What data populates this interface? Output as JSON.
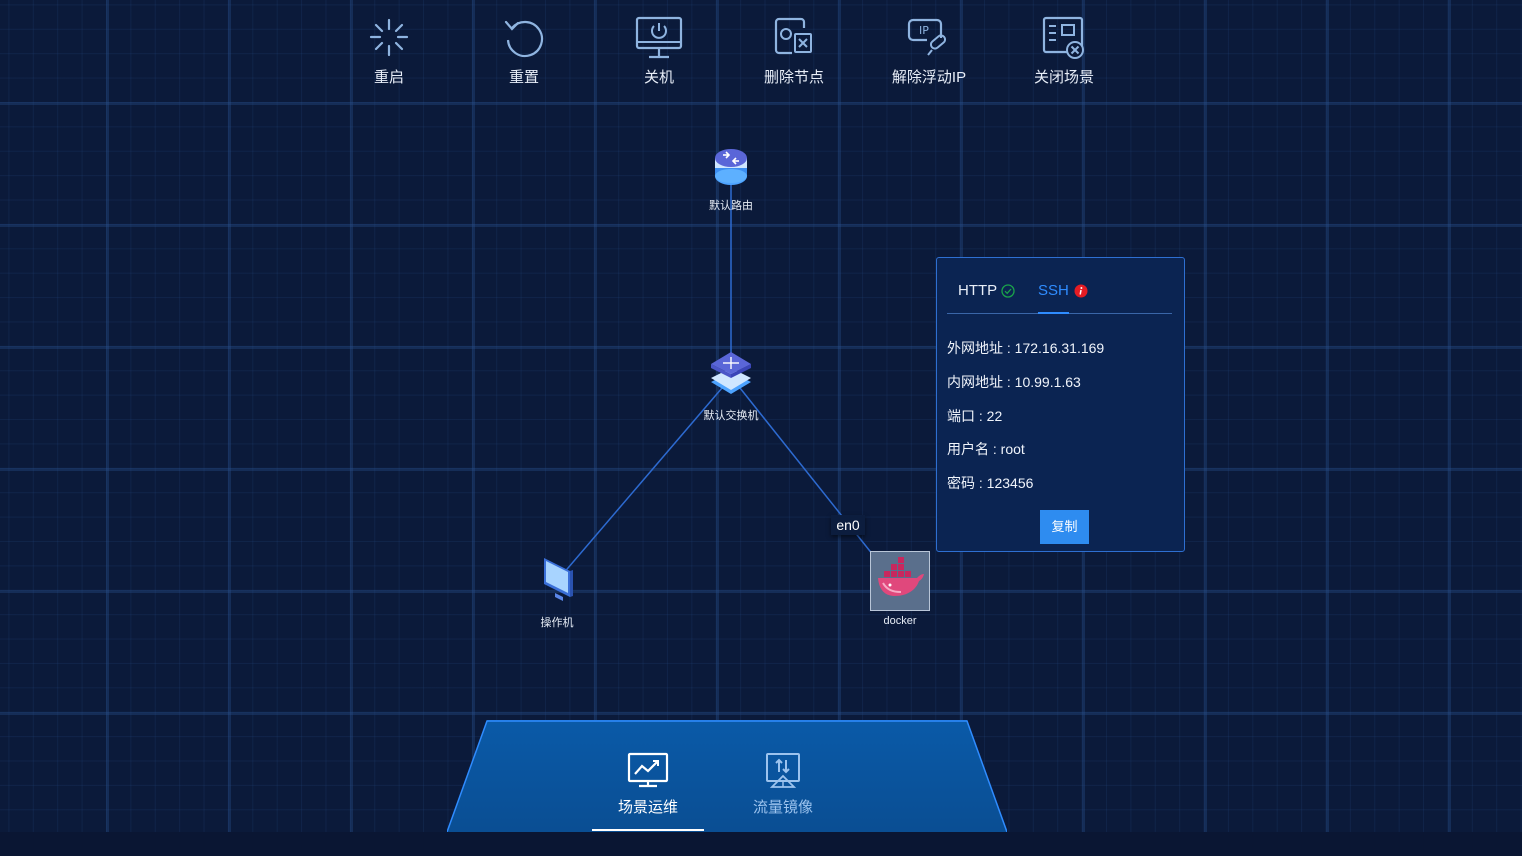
{
  "toolbar": {
    "items": [
      {
        "label": "重启",
        "icon": "spinner-icon"
      },
      {
        "label": "重置",
        "icon": "reset-icon"
      },
      {
        "label": "关机",
        "icon": "power-monitor-icon"
      },
      {
        "label": "删除节点",
        "icon": "delete-node-icon"
      },
      {
        "label": "解除浮动IP",
        "icon": "release-ip-icon"
      },
      {
        "label": "关闭场景",
        "icon": "close-scene-icon"
      }
    ]
  },
  "topology": {
    "nodes": {
      "router": "默认路由",
      "switch": "默认交换机",
      "operator": "操作机",
      "docker": "docker"
    },
    "link_label": "en0"
  },
  "panel": {
    "tabs": {
      "http": "HTTP",
      "ssh": "SSH"
    },
    "rows": {
      "external": "外网地址 : 172.16.31.169",
      "internal": "内网地址 : 10.99.1.63",
      "port": "端口 : 22",
      "username": "用户名 : root",
      "password": "密码 : 123456"
    },
    "copy_label": "复制"
  },
  "bottom_nav": {
    "items": [
      {
        "label": "场景运维",
        "icon": "chart-monitor-icon",
        "active": true
      },
      {
        "label": "流量镜像",
        "icon": "traffic-mirror-icon",
        "active": false
      }
    ]
  },
  "colors": {
    "background": "#0b1a3a",
    "accent": "#2e8cf0",
    "success": "#1aa34a",
    "error": "#e51c23"
  }
}
